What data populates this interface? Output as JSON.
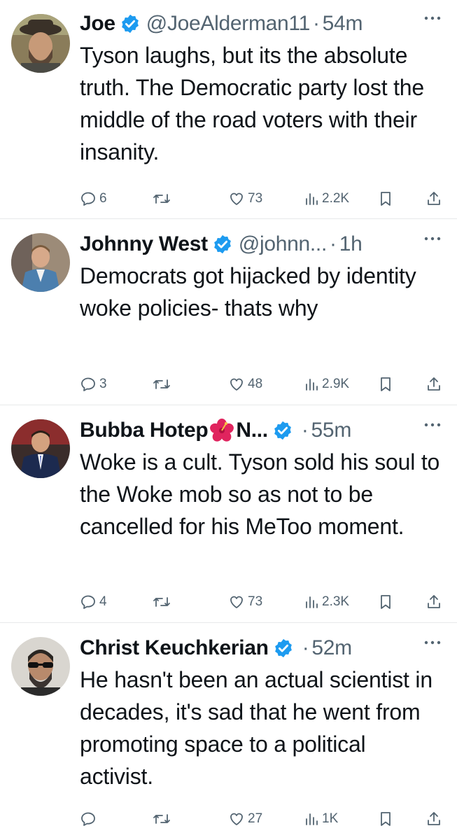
{
  "colors": {
    "text": "#0f1419",
    "secondary": "#536471",
    "verified": "#1d9bf0",
    "divider": "#e7e9ea"
  },
  "icons": {
    "reply": "speech-bubble-icon",
    "repost": "repost-arrows-icon",
    "like": "heart-icon",
    "views": "bar-chart-icon",
    "bookmark": "bookmark-icon",
    "share": "share-upload-icon",
    "more": "ellipsis-icon",
    "verified": "verified-badge-icon"
  },
  "tweets": [
    {
      "name": "Joe",
      "handle": "@JoeAlderman11",
      "separator": "·",
      "time": "54m",
      "text": "Tyson laughs, but its the absolute truth. The Democratic party lost the middle of the road voters with their insanity.",
      "replies": "6",
      "likes": "73",
      "views": "2.2K"
    },
    {
      "name": "Johnny West",
      "handle": "@johnn...",
      "separator": "·",
      "time": "1h",
      "text": "Democrats got hijacked by identity woke policies- thats why",
      "replies": "3",
      "likes": "48",
      "views": "2.9K"
    },
    {
      "name": "Bubba Hotep",
      "name_suffix": "N...",
      "name_emoji": "hibiscus-flower-icon",
      "separator": "·",
      "time": "55m",
      "text": "Woke is a cult. Tyson sold his soul to the Woke mob so as not to be cancelled for his MeToo moment.",
      "replies": "4",
      "likes": "73",
      "views": "2.3K"
    },
    {
      "name": "Christ Keuchkerian",
      "separator": "·",
      "time": "52m",
      "text": "He hasn't been an actual scientist in decades, it's sad that he went from promoting space to a political activist.",
      "replies": "",
      "likes": "27",
      "views": "1K"
    }
  ]
}
